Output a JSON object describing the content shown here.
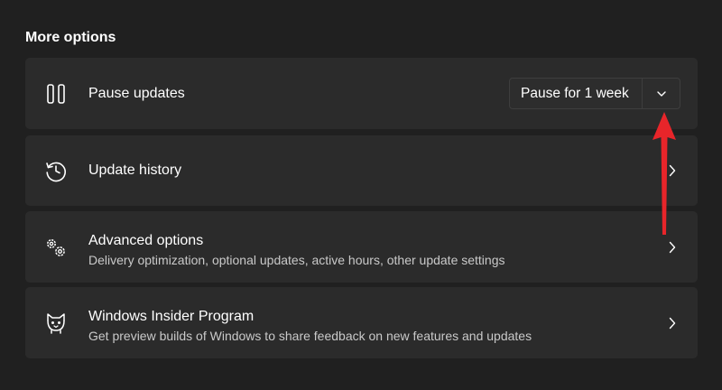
{
  "section": {
    "title": "More options"
  },
  "pause_updates": {
    "icon": "pause-icon",
    "title": "Pause updates",
    "dropdown_value": "Pause for 1 week",
    "dropdown_icon": "chevron-down-icon"
  },
  "update_history": {
    "icon": "history-icon",
    "title": "Update history"
  },
  "advanced_options": {
    "icon": "gears-icon",
    "title": "Advanced options",
    "subtitle": "Delivery optimization, optional updates, active hours, other update settings"
  },
  "insider_program": {
    "icon": "insider-cat-icon",
    "title": "Windows Insider Program",
    "subtitle": "Get preview builds of Windows to share feedback on new features and updates"
  },
  "colors": {
    "background": "#202020",
    "card": "#2b2b2b",
    "annotation_arrow": "#e8252a"
  }
}
